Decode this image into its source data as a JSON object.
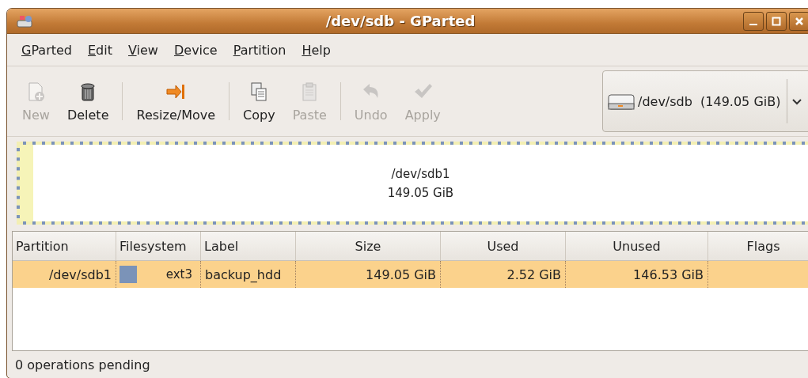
{
  "window": {
    "title": "/dev/sdb - GParted"
  },
  "menu": [
    {
      "mnemonic": "G",
      "rest": "Parted"
    },
    {
      "mnemonic": "E",
      "rest": "dit"
    },
    {
      "mnemonic": "V",
      "rest": "iew"
    },
    {
      "mnemonic": "D",
      "rest": "evice"
    },
    {
      "mnemonic": "P",
      "rest": "artition"
    },
    {
      "mnemonic": "H",
      "rest": "elp"
    }
  ],
  "toolbar": [
    [
      {
        "label": "New",
        "kind": "new",
        "disabled": true
      },
      {
        "label": "Delete",
        "kind": "delete",
        "disabled": false
      }
    ],
    [
      {
        "label": "Resize/Move",
        "kind": "resize",
        "disabled": false
      }
    ],
    [
      {
        "label": "Copy",
        "kind": "copy",
        "disabled": false
      },
      {
        "label": "Paste",
        "kind": "paste",
        "disabled": true
      }
    ],
    [
      {
        "label": "Undo",
        "kind": "undo",
        "disabled": true
      },
      {
        "label": "Apply",
        "kind": "apply",
        "disabled": true
      }
    ]
  ],
  "device_selector": {
    "value": "/dev/sdb  (149.05 GiB)"
  },
  "disk_map": {
    "partitions": [
      {
        "name": "/dev/sdb1",
        "size": "149.05 GiB",
        "level": 0.017,
        "color": "#7b93b8",
        "selected": true
      }
    ]
  },
  "table": {
    "columns": [
      "Partition",
      "Filesystem",
      "Label",
      "Size",
      "Used",
      "Unused",
      "Flags"
    ],
    "rows": [
      {
        "partition": "/dev/sdb1",
        "color": "#7b93b8",
        "filesystem": "ext3",
        "label": "backup_hdd",
        "size": "149.05 GiB",
        "used": "2.52 GiB",
        "unused": "146.53 GiB",
        "selected": true
      }
    ]
  },
  "status_bar": {
    "text": "0 operations pending"
  }
}
